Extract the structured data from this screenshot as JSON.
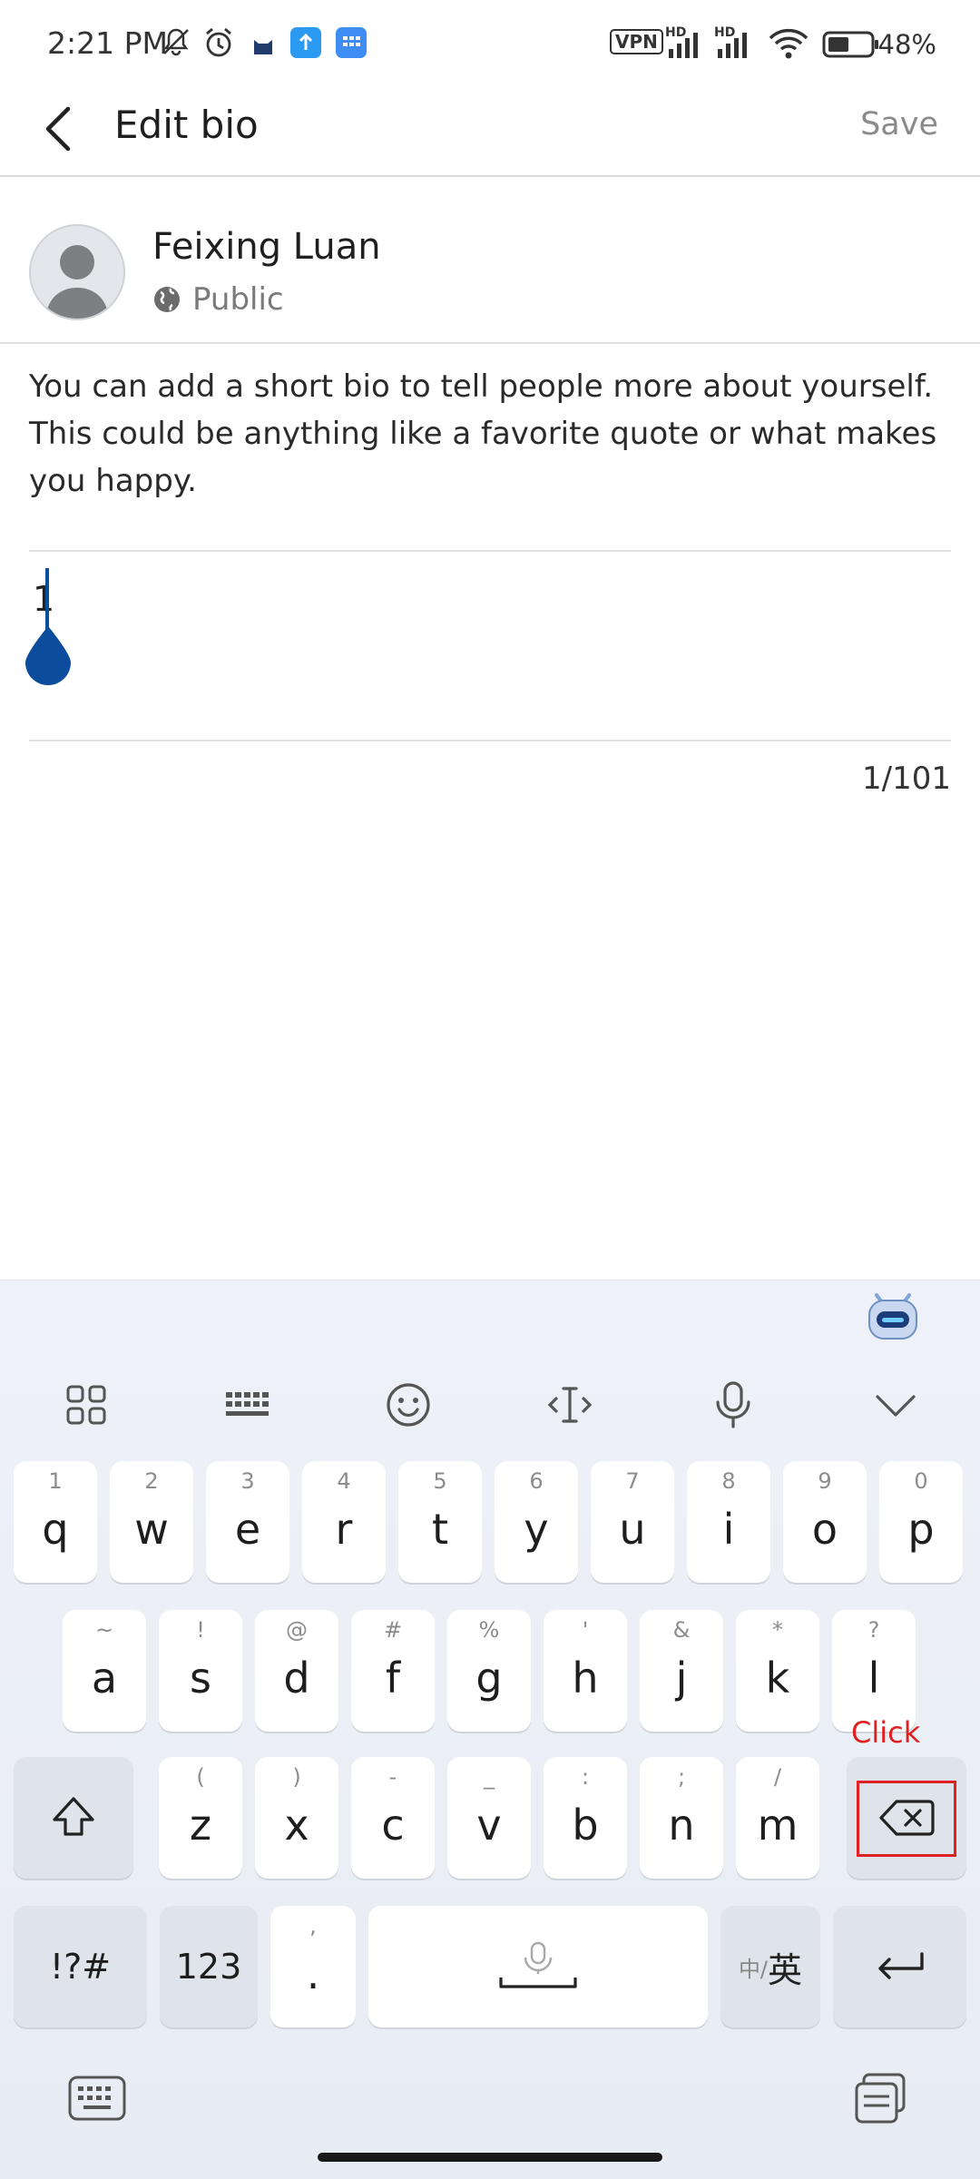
{
  "status_bar": {
    "time": "2:21 PM",
    "vpn_label": "VPN",
    "network_label_1": "HD",
    "network_label_2": "HD",
    "battery_percent": "48%",
    "icons": [
      "bell-off-icon",
      "alarm-icon",
      "cat-icon",
      "upload-icon",
      "grid-app-icon",
      "vpn-icon",
      "signal-icon",
      "signal-icon",
      "wifi-icon",
      "battery-icon"
    ]
  },
  "header": {
    "title": "Edit bio",
    "save_label": "Save"
  },
  "profile": {
    "name": "Feixing Luan",
    "privacy": "Public"
  },
  "description": "You can add a short bio to tell people more about yourself. This could be anything like a favorite quote or what makes you happy.",
  "bio": {
    "value": "1",
    "char_count": "1/101"
  },
  "keyboard": {
    "toolbar_icons": [
      "apps-grid-icon",
      "keyboard-layout-icon",
      "emoji-icon",
      "text-cursor-icon",
      "microphone-icon",
      "chevron-down-icon"
    ],
    "row1": [
      {
        "hint": "1",
        "key": "q"
      },
      {
        "hint": "2",
        "key": "w"
      },
      {
        "hint": "3",
        "key": "e"
      },
      {
        "hint": "4",
        "key": "r"
      },
      {
        "hint": "5",
        "key": "t"
      },
      {
        "hint": "6",
        "key": "y"
      },
      {
        "hint": "7",
        "key": "u"
      },
      {
        "hint": "8",
        "key": "i"
      },
      {
        "hint": "9",
        "key": "o"
      },
      {
        "hint": "0",
        "key": "p"
      }
    ],
    "row2": [
      {
        "hint": "~",
        "key": "a"
      },
      {
        "hint": "!",
        "key": "s"
      },
      {
        "hint": "@",
        "key": "d"
      },
      {
        "hint": "#",
        "key": "f"
      },
      {
        "hint": "%",
        "key": "g"
      },
      {
        "hint": "'",
        "key": "h"
      },
      {
        "hint": "&",
        "key": "j"
      },
      {
        "hint": "*",
        "key": "k"
      },
      {
        "hint": "?",
        "key": "l"
      }
    ],
    "row3": [
      {
        "hint": "(",
        "key": "z"
      },
      {
        "hint": ")",
        "key": "x"
      },
      {
        "hint": "-",
        "key": "c"
      },
      {
        "hint": "_",
        "key": "v"
      },
      {
        "hint": ":",
        "key": "b"
      },
      {
        "hint": ";",
        "key": "n"
      },
      {
        "hint": "/",
        "key": "m"
      }
    ],
    "symbols_label": "!?#",
    "numbers_label": "123",
    "comma_hint": ",",
    "period_label": ".",
    "lang_label_small": "中/",
    "lang_label_big": "英"
  },
  "annotation": {
    "click_label": "Click",
    "color": "#e02020"
  },
  "colors": {
    "accent": "#0b4d9c",
    "divider": "#e2e2e2"
  }
}
